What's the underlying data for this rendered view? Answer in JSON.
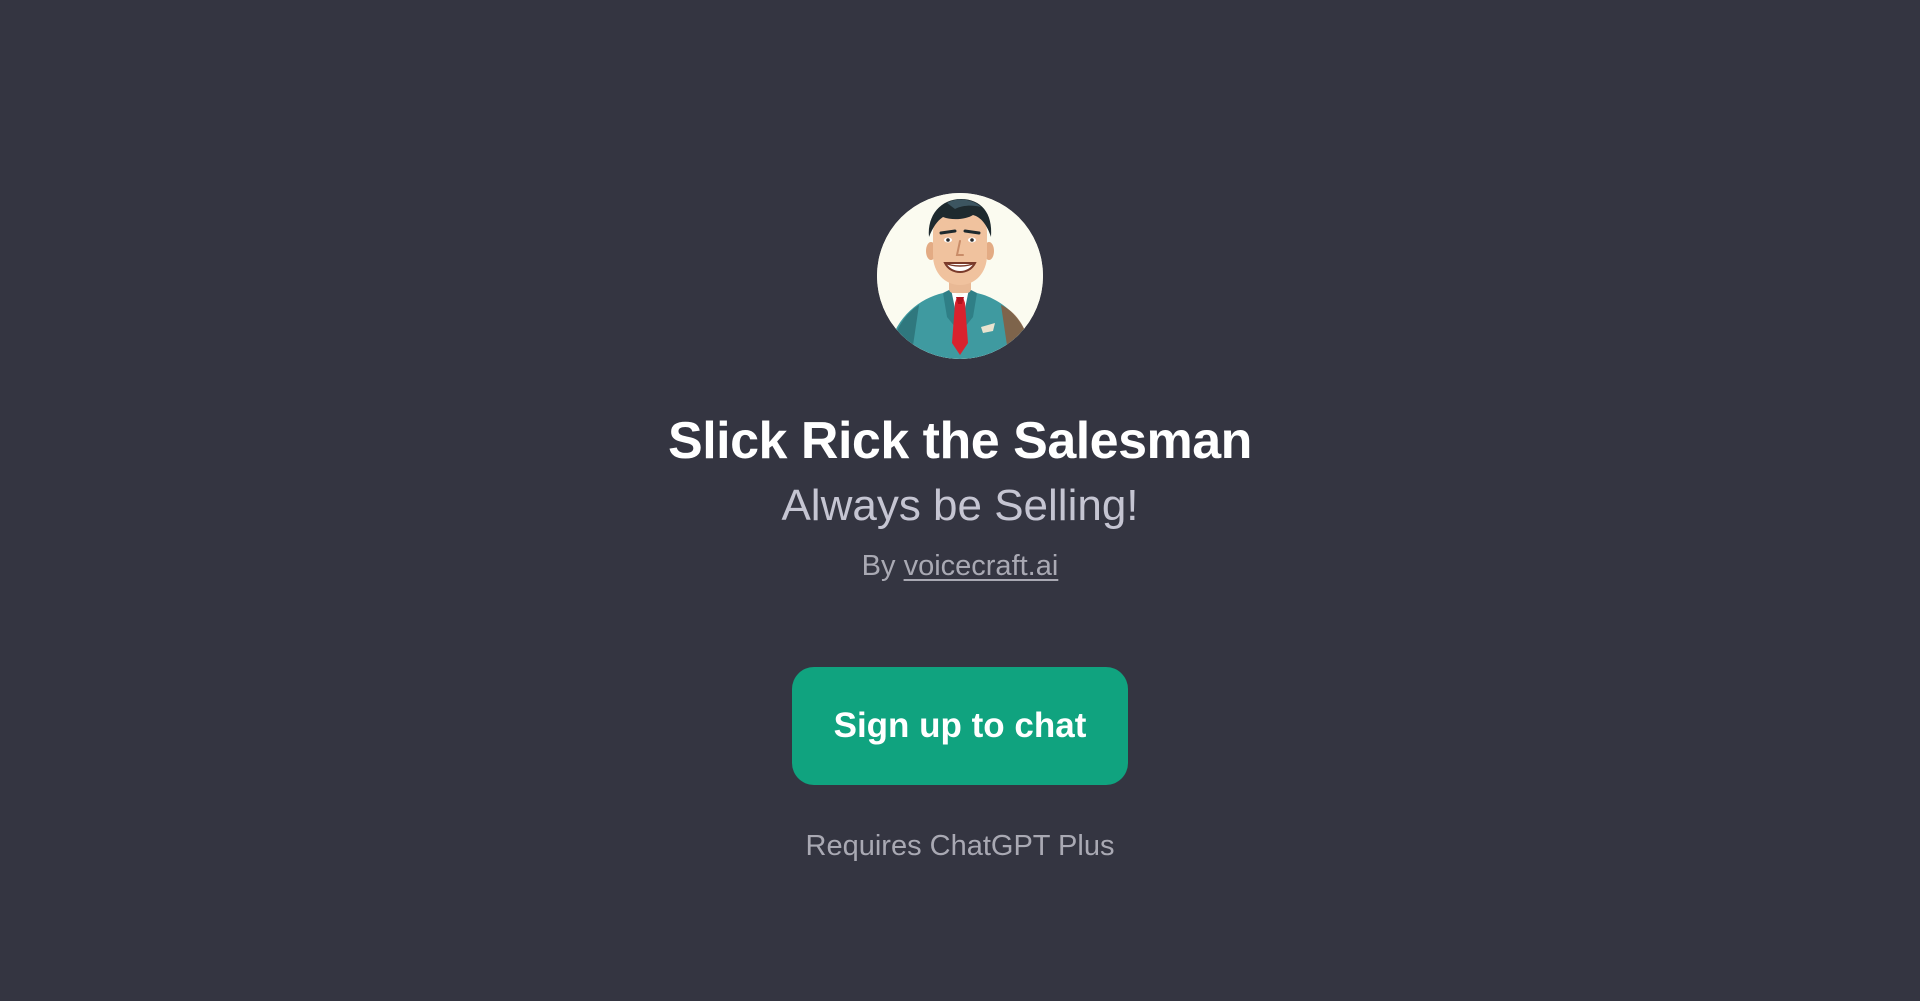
{
  "gpt": {
    "avatar_alt": "Slick Rick the Salesman avatar",
    "title": "Slick Rick the Salesman",
    "subtitle": "Always be Selling!",
    "by_prefix": "By",
    "author": "voicecraft.ai"
  },
  "cta": {
    "label": "Sign up to chat",
    "color": "#10a37f"
  },
  "footer": {
    "note": "Requires ChatGPT Plus"
  },
  "theme": {
    "background": "#343541",
    "title_color": "#ffffff",
    "subtitle_color": "#c5c5d2",
    "muted_color": "#a9a9b3"
  }
}
